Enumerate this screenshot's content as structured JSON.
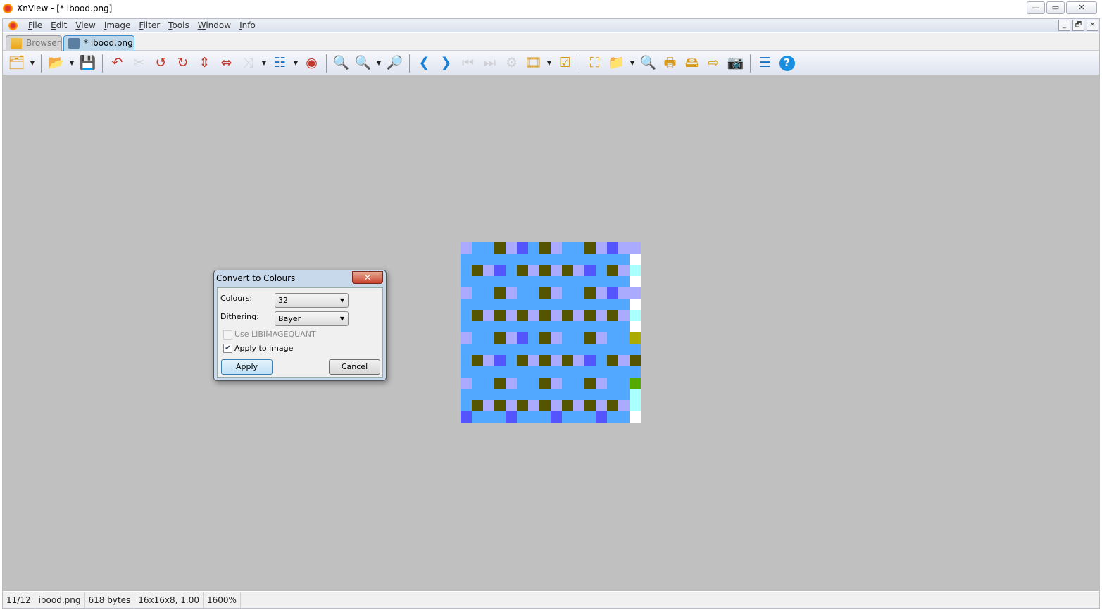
{
  "window": {
    "title": "XnView - [* ibood.png]",
    "min": "—",
    "max": "▭",
    "close": "✕"
  },
  "menu": [
    "File",
    "Edit",
    "View",
    "Image",
    "Filter",
    "Tools",
    "Window",
    "Info"
  ],
  "mdi_buttons": [
    "_",
    "🗗",
    "✕"
  ],
  "tabs": [
    {
      "label": "Browser"
    },
    {
      "label": "* ibood.png"
    }
  ],
  "toolbar": [
    {
      "icon": "browse-folders",
      "glyph": "🗂",
      "dd": true
    },
    "sep",
    {
      "icon": "open",
      "glyph": "📂",
      "dd": true
    },
    {
      "icon": "save",
      "glyph": "💾"
    },
    "sep",
    {
      "icon": "undo",
      "glyph": "↶"
    },
    {
      "icon": "cut",
      "glyph": "✂",
      "disabled": true
    },
    {
      "icon": "rotate-left",
      "glyph": "↺"
    },
    {
      "icon": "rotate-right",
      "glyph": "↻"
    },
    {
      "icon": "flip-vertical",
      "glyph": "⇕"
    },
    {
      "icon": "flip-horizontal",
      "glyph": "⇔"
    },
    {
      "icon": "transform",
      "glyph": "⤨",
      "disabled": true,
      "dd": true
    },
    {
      "icon": "adjust",
      "glyph": "☷",
      "dd": true
    },
    {
      "icon": "red-eye",
      "glyph": "◉"
    },
    "sep",
    {
      "icon": "zoom-in",
      "glyph": "🔍"
    },
    {
      "icon": "zoom-out",
      "glyph": "🔍",
      "dd": true
    },
    {
      "icon": "zoom-fit",
      "glyph": "🔎"
    },
    "sep",
    {
      "icon": "previous",
      "glyph": "❮"
    },
    {
      "icon": "next",
      "glyph": "❯"
    },
    {
      "icon": "first",
      "glyph": "⏮",
      "disabled": true
    },
    {
      "icon": "last",
      "glyph": "⏭",
      "disabled": true
    },
    {
      "icon": "slideshow",
      "glyph": "⚙",
      "disabled": true
    },
    {
      "icon": "filmstrip",
      "glyph": "🎞",
      "dd": true
    },
    {
      "icon": "tag",
      "glyph": "☑"
    },
    "sep",
    {
      "icon": "fullscreen",
      "glyph": "⛶"
    },
    {
      "icon": "open-with",
      "glyph": "📁",
      "dd": true
    },
    {
      "icon": "find",
      "glyph": "🔍"
    },
    {
      "icon": "print",
      "glyph": "🖶"
    },
    {
      "icon": "scan",
      "glyph": "🖴"
    },
    {
      "icon": "convert",
      "glyph": "⇨"
    },
    {
      "icon": "capture",
      "glyph": "📷"
    },
    "sep",
    {
      "icon": "properties",
      "glyph": "☰"
    },
    {
      "icon": "help",
      "glyph": "?"
    }
  ],
  "image": {
    "palette": {
      "B": "#52a8ff",
      "L": "#aaaaff",
      "O": "#555500",
      "P": "#5555ff",
      "W": "#ffffff",
      "C": "#aaffff",
      "Y": "#aaaa00",
      "G": "#55aa00"
    },
    "rows": [
      "LBBOLPBOLBBOLPLL",
      "BBBBBBBBBBBBBBBW",
      "BOLPBOLOLOLPBOLC",
      "BBBBBBBBBBBBBBBW",
      "LBBOLBBOLBBOLPLL",
      "BBBBBBBBBBBBBBBW",
      "BOLOLOLOLOLOLOLC",
      "BBBBBBBBBBBBBBBW",
      "LBBOLPBOLBBOLBBY",
      "BBBBBBBBBBBBBBBB",
      "BOLPBOLOLOLPBOLO",
      "BBBBBBBBBBBBBBBB",
      "LBBOLBBOLBBOLBBG",
      "BBBBBBBBBBBBBBBC",
      "BOLOLOLOLOLOLOLC",
      "PBBBPBBBPBBBPBBW"
    ]
  },
  "dialog": {
    "title": "Convert to Colours",
    "close": "✕",
    "colours_label": "Colours:",
    "colours_value": "32",
    "dithering_label": "Dithering:",
    "dithering_value": "Bayer",
    "libimagequant_label": "Use LIBIMAGEQUANT",
    "libimagequant_checked": false,
    "apply_to_image_label": "Apply to image",
    "apply_to_image_check": "✔",
    "apply_label": "Apply",
    "cancel_label": "Cancel"
  },
  "status": {
    "index": "11/12",
    "filename": "ibood.png",
    "size": "618 bytes",
    "dims": "16x16x8, 1.00",
    "zoom": "1600%"
  }
}
